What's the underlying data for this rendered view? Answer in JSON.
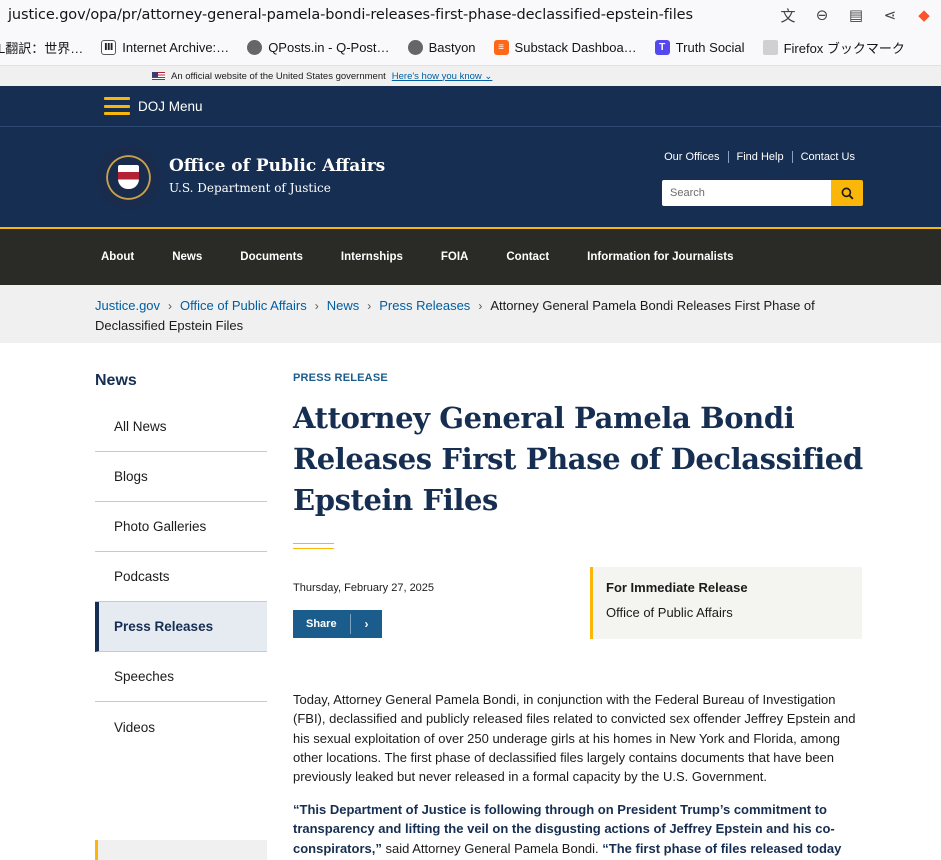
{
  "browser": {
    "url": "justice.gov/opa/pr/attorney-general-pamela-bondi-releases-first-phase-declassified-epstein-files",
    "icons": [
      "translate-icon",
      "zoom-icon",
      "reader-icon",
      "share-icon",
      "brave-icon"
    ],
    "bookmarks": [
      {
        "label": "L翻訳：世界…",
        "icon": "translate-bookmark-icon",
        "color": "#ffffff"
      },
      {
        "label": "Internet Archive:…",
        "icon": "archive-icon",
        "color": "#222222"
      },
      {
        "label": "QPosts.in - Q-Post…",
        "icon": "globe-icon",
        "color": "#555555"
      },
      {
        "label": "Bastyon",
        "icon": "globe-icon",
        "color": "#555555"
      },
      {
        "label": "Substack Dashboa…",
        "icon": "substack-icon",
        "color": "#ff6719"
      },
      {
        "label": "Truth Social",
        "icon": "truth-social-icon",
        "color": "#5448ee"
      },
      {
        "label": "Firefox ブックマーク",
        "icon": "folder-icon",
        "color": "#cccccc"
      }
    ]
  },
  "gov_banner": {
    "text": "An official website of the United States government",
    "link": "Here's how you know"
  },
  "doj_menu": {
    "label": "DOJ Menu"
  },
  "header": {
    "title": "Office of Public Affairs",
    "subtitle": "U.S. Department of Justice",
    "utility_links": [
      "Our Offices",
      "Find Help",
      "Contact Us"
    ],
    "search_placeholder": "Search"
  },
  "main_nav": [
    "About",
    "News",
    "Documents",
    "Internships",
    "FOIA",
    "Contact",
    "Information for Journalists"
  ],
  "breadcrumb": {
    "links": [
      "Justice.gov",
      "Office of Public Affairs",
      "News",
      "Press Releases"
    ],
    "current": "Attorney General Pamela Bondi Releases First Phase of Declassified Epstein Files"
  },
  "sidebar": {
    "title": "News",
    "items": [
      "All News",
      "Blogs",
      "Photo Galleries",
      "Podcasts",
      "Press Releases",
      "Speeches",
      "Videos"
    ],
    "active": "Press Releases"
  },
  "article": {
    "kicker": "PRESS RELEASE",
    "headline": "Attorney General Pamela Bondi Releases First Phase of Declassified Epstein Files",
    "date": "Thursday, February 27, 2025",
    "share_label": "Share",
    "release_label": "For Immediate Release",
    "release_office": "Office of Public Affairs",
    "body": "Today, Attorney General Pamela Bondi, in conjunction with the Federal Bureau of Investigation (FBI), declassified and publicly released files related to convicted sex offender Jeffrey Epstein and his sexual exploitation of over 250 underage girls at his homes in New York and Florida, among other locations. The first phase of declassified files largely contains documents that have been previously leaked but never released in a formal capacity by the U.S. Government.",
    "quote_bold": "“This Department of Justice is following through on President Trump’s commitment to transparency and lifting the veil on the disgusting actions of Jeffrey Epstein and his co-conspirators,”",
    "quote_attr": " said Attorney General Pamela Bondi. ",
    "quote_bold2": "“The first phase of files released today"
  },
  "colors": {
    "navy": "#162e51",
    "gold": "#fab70a",
    "link": "#005ea2",
    "nav_bg": "#2a2a27"
  }
}
